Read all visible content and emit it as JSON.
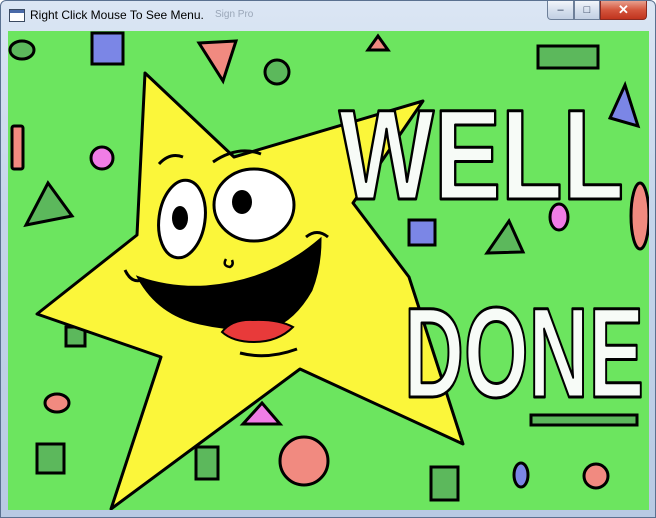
{
  "window": {
    "title": "Right Click Mouse To See Menu.",
    "ghost_title": "Sign Pro",
    "minimize_symbol": "–",
    "maximize_symbol": "□",
    "close_symbol": "✕"
  },
  "artwork": {
    "headline_line1": "WELL",
    "headline_line2": "DONE",
    "colors": {
      "background": "#6ce55f",
      "star": "#fbf63a",
      "letters": "#f7fbf7",
      "outline": "#000000",
      "shape_green": "#5cb85c",
      "shape_blue": "#7b86e6",
      "shape_salmon": "#f18a80",
      "shape_pink": "#f07de6",
      "mouth": "#e83a3a"
    },
    "icons": [
      "star-cartoon-icon"
    ]
  }
}
